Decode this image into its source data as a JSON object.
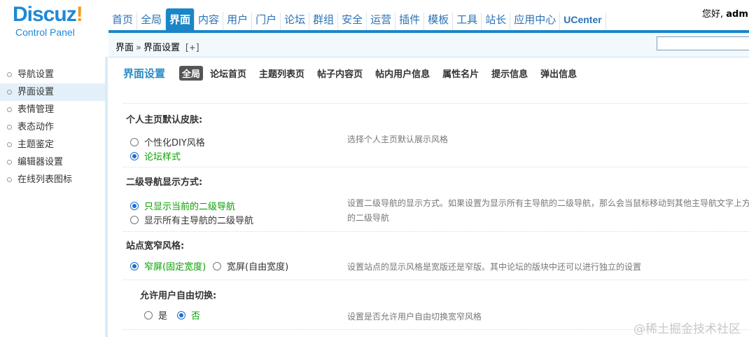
{
  "logo": {
    "main": "Discuz",
    "bang": "!",
    "sub": "Control Panel"
  },
  "topnav": {
    "items": [
      {
        "label": "首页"
      },
      {
        "label": "全局"
      },
      {
        "label": "界面",
        "active": true
      },
      {
        "label": "内容"
      },
      {
        "label": "用户"
      },
      {
        "label": "门户"
      },
      {
        "label": "论坛"
      },
      {
        "label": "群组"
      },
      {
        "label": "安全"
      },
      {
        "label": "运营"
      },
      {
        "label": "插件"
      },
      {
        "label": "模板"
      },
      {
        "label": "工具"
      },
      {
        "label": "站长"
      },
      {
        "label": "应用中心"
      },
      {
        "label": "UCenter"
      }
    ],
    "greeting": "您好, ",
    "username": "admin"
  },
  "breadcrumb": {
    "parent": "界面",
    "separator": "»",
    "current": "界面设置",
    "add": "[+]"
  },
  "search": {
    "value": ""
  },
  "sidebar": {
    "items": [
      {
        "label": "导航设置"
      },
      {
        "label": "界面设置",
        "active": true
      },
      {
        "label": "表情管理"
      },
      {
        "label": "表态动作"
      },
      {
        "label": "主题鉴定"
      },
      {
        "label": "编辑器设置"
      },
      {
        "label": "在线列表图标"
      }
    ]
  },
  "main": {
    "title": "界面设置",
    "tabs": [
      {
        "label": "全局",
        "active": true
      },
      {
        "label": "论坛首页"
      },
      {
        "label": "主题列表页"
      },
      {
        "label": "帖子内容页"
      },
      {
        "label": "帖内用户信息"
      },
      {
        "label": "属性名片"
      },
      {
        "label": "提示信息"
      },
      {
        "label": "弹出信息"
      }
    ],
    "sections": {
      "home_skin": {
        "title": "个人主页默认皮肤:",
        "options": [
          "个性化DIY风格",
          "论坛样式"
        ],
        "selected": 1,
        "desc": "选择个人主页默认展示风格"
      },
      "subnav": {
        "title": "二级导航显示方式:",
        "options": [
          "只显示当前的二级导航",
          "显示所有主导航的二级导航"
        ],
        "selected": 0,
        "desc_line1": "设置二级导航的显示方式。如果设置为显示所有主导航的二级导航，那么会当鼠标移动到其他主导航文字上方",
        "desc_line2": "的二级导航"
      },
      "width": {
        "title": "站点宽窄风格:",
        "options": [
          "窄屏(固定宽度)",
          "宽屏(自由宽度)"
        ],
        "selected": 0,
        "desc": "设置站点的显示风格是宽版还是窄版。其中论坛的版块中还可以进行独立的设置"
      },
      "allow_switch": {
        "title": "允许用户自由切换:",
        "options": [
          "是",
          "否"
        ],
        "selected": 1,
        "desc": "设置是否允许用户自由切换宽窄风格"
      }
    }
  },
  "watermark": "@稀土掘金技术社区"
}
